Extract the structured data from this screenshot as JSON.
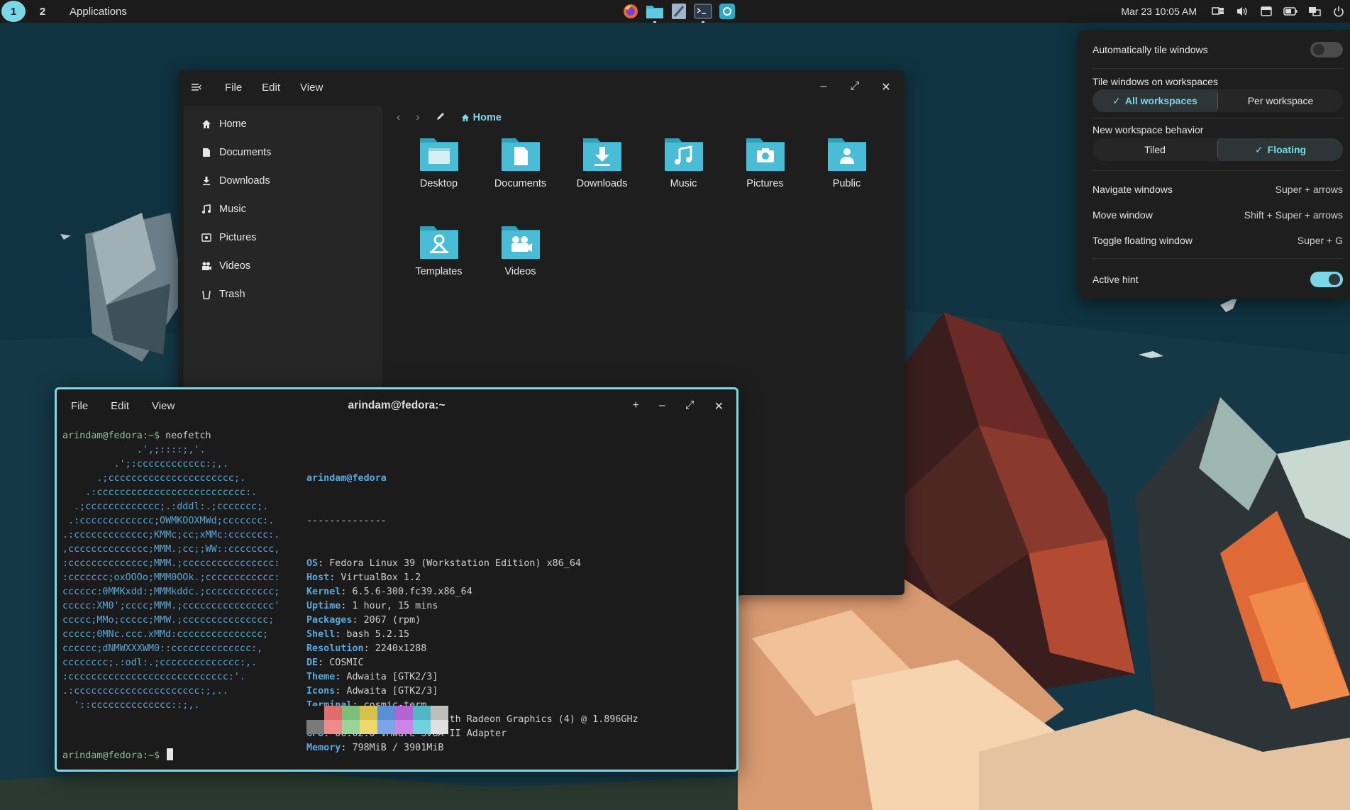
{
  "panel": {
    "workspace_1": "1",
    "workspace_2": "2",
    "applications": "Applications",
    "clock": "Mar 23 10:05 AM"
  },
  "files": {
    "menu": {
      "file": "File",
      "edit": "Edit",
      "view": "View"
    },
    "sidebar": [
      {
        "label": "Home",
        "icon": "home-icon"
      },
      {
        "label": "Documents",
        "icon": "document-icon"
      },
      {
        "label": "Downloads",
        "icon": "download-icon"
      },
      {
        "label": "Music",
        "icon": "music-icon"
      },
      {
        "label": "Pictures",
        "icon": "picture-icon"
      },
      {
        "label": "Videos",
        "icon": "video-icon"
      },
      {
        "label": "Trash",
        "icon": "trash-icon"
      }
    ],
    "breadcrumb": "Home",
    "folders": [
      {
        "label": "Desktop",
        "icon": "desktop-folder-icon"
      },
      {
        "label": "Documents",
        "icon": "documents-folder-icon"
      },
      {
        "label": "Downloads",
        "icon": "downloads-folder-icon"
      },
      {
        "label": "Music",
        "icon": "music-folder-icon"
      },
      {
        "label": "Pictures",
        "icon": "pictures-folder-icon"
      },
      {
        "label": "Public",
        "icon": "public-folder-icon"
      },
      {
        "label": "Templates",
        "icon": "templates-folder-icon"
      },
      {
        "label": "Videos",
        "icon": "videos-folder-icon"
      }
    ]
  },
  "terminal": {
    "menu": {
      "file": "File",
      "edit": "Edit",
      "view": "View"
    },
    "title": "arindam@fedora:~",
    "prompt": "arindam@fedora:~$",
    "command": " neofetch",
    "info_header": "arindam@fedora",
    "info_rule": "--------------",
    "info": [
      {
        "k": "OS",
        "v": ": Fedora Linux 39 (Workstation Edition) x86_64"
      },
      {
        "k": "Host",
        "v": ": VirtualBox 1.2"
      },
      {
        "k": "Kernel",
        "v": ": 6.5.6-300.fc39.x86_64"
      },
      {
        "k": "Uptime",
        "v": ": 1 hour, 15 mins"
      },
      {
        "k": "Packages",
        "v": ": 2067 (rpm)"
      },
      {
        "k": "Shell",
        "v": ": bash 5.2.15"
      },
      {
        "k": "Resolution",
        "v": ": 2240x1288"
      },
      {
        "k": "DE",
        "v": ": COSMIC"
      },
      {
        "k": "Theme",
        "v": ": Adwaita [GTK2/3]"
      },
      {
        "k": "Icons",
        "v": ": Adwaita [GTK2/3]"
      },
      {
        "k": "Terminal",
        "v": ": cosmic-term"
      },
      {
        "k": "CPU",
        "v": ": AMD Ryzen 7 5800U with Radeon Graphics (4) @ 1.896GHz"
      },
      {
        "k": "GPU",
        "v": ": 00:02.0 VMware SVGA II Adapter"
      },
      {
        "k": "Memory",
        "v": ": 798MiB / 3901MiB"
      }
    ],
    "logo": [
      "             .',;::::;,'.",
      "         .';:cccccccccccc:;,.",
      "      .;cccccccccccccccccccccc;.",
      "    .:cccccccccccccccccccccccccc:.",
      "  .;ccccccccccccc;.:dddl:.;ccccccc;.",
      " .:ccccccccccccc;OWMKOOXMWd;ccccccc:.",
      ".:ccccccccccccc;KMMc;cc;xMMc:ccccccc:.",
      ",cccccccccccccc;MMM.;cc;;WW::cccccccc,",
      ":cccccccccccccc;MMM.;cccccccccccccccc:",
      ":ccccccc;oxOOOo;MMM0OOk.;cccccccccccc:",
      "cccccc:0MMKxdd:;MMMkddc.;cccccccccccc;",
      "ccccc:XM0';cccc;MMM.;cccccccccccccccc'",
      "ccccc;MMo;ccccc;MMW.;ccccccccccccccc;",
      "ccccc;0MNc.ccc.xMMd:ccccccccccccccc;",
      "cccccc;dNMWXXXWM0::cccccccccccccc:,",
      "cccccccc;.:odl:.;cccccccccccccc:,.",
      ":cccccccccccccccccccccccccccc:'.",
      ".:cccccccccccccccccccccc:;,..",
      "  '::cccccccccccccc::;,."
    ],
    "palette_top": [
      "#1b1b1b",
      "#e06c6c",
      "#7cbf7c",
      "#d6c24a",
      "#5a8fd6",
      "#b463d6",
      "#4fb8c4",
      "#bdbdbd"
    ],
    "palette_bottom": [
      "#7a7a7a",
      "#f08a8a",
      "#9ad49a",
      "#eed86a",
      "#7aa6e6",
      "#cc85e6",
      "#6fd2dc",
      "#e0e0e0"
    ]
  },
  "tiling": {
    "auto_tile_label": "Automatically tile windows",
    "auto_tile_on": false,
    "tile_on_label": "Tile windows on workspaces",
    "all_workspaces": "All workspaces",
    "per_workspace": "Per workspace",
    "new_ws_label": "New workspace behavior",
    "tiled": "Tiled",
    "floating": "Floating",
    "shortcuts": [
      {
        "label": "Navigate windows",
        "keys": "Super + arrows"
      },
      {
        "label": "Move window",
        "keys": "Shift + Super + arrows"
      },
      {
        "label": "Toggle floating window",
        "keys": "Super + G"
      }
    ],
    "active_hint_label": "Active hint",
    "active_hint_on": true
  },
  "colors": {
    "accent": "#7ad7e6",
    "window_bg": "#1e1e1e",
    "sidebar_bg": "#262626",
    "panel_bg": "#1b1b1b"
  }
}
